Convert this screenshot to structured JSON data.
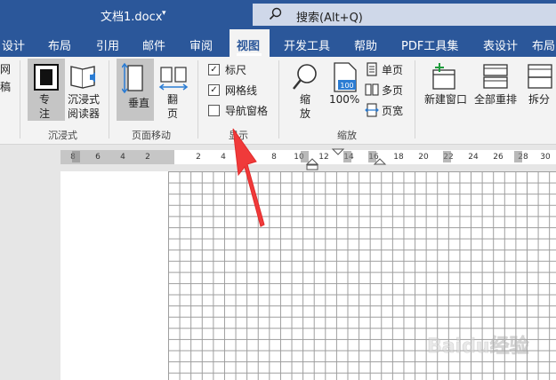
{
  "window": {
    "title": "文档1.docx",
    "title_caret": "▾"
  },
  "search": {
    "label": "搜索(Alt+Q)"
  },
  "tabs": [
    "设计",
    "布局",
    "引用",
    "邮件",
    "审阅",
    "视图",
    "开发工具",
    "帮助",
    "PDF工具集",
    "表设计",
    "布局"
  ],
  "active_tab": "视图",
  "ribbon": {
    "left_partial": {
      "line1": "网",
      "line2": "稿"
    },
    "immersive": {
      "group_label": "沉浸式",
      "focus": {
        "line1": "专",
        "line2": "注"
      },
      "reader": {
        "line1": "沉浸式",
        "line2": "阅读器"
      }
    },
    "page_move": {
      "group_label": "页面移动",
      "vertical": {
        "label": "垂直"
      },
      "flip": {
        "line1": "翻",
        "line2": "页"
      }
    },
    "show": {
      "group_label": "显示",
      "ruler": {
        "label": "标尺",
        "checked": true,
        "mark": "✓"
      },
      "gridlines": {
        "label": "网格线",
        "checked": true,
        "mark": "✓"
      },
      "nav_pane": {
        "label": "导航窗格",
        "checked": false
      }
    },
    "zoom": {
      "group_label": "缩放",
      "zoom": {
        "line1": "缩",
        "line2": "放"
      },
      "hundred": {
        "badge": "100",
        "label": "100%"
      },
      "single": {
        "label": "单页"
      },
      "multi": {
        "label": "多页"
      },
      "width": {
        "label": "页宽"
      }
    },
    "window_group": {
      "new_window": {
        "label": "新建窗口"
      },
      "arrange_all": {
        "label": "全部重排"
      },
      "split": {
        "label": "拆分"
      }
    }
  },
  "ruler": {
    "left_ticks": [
      "8",
      "6",
      "4",
      "2"
    ],
    "right_ticks": [
      "2",
      "4",
      "6",
      "8",
      "10",
      "12",
      "14",
      "16",
      "18",
      "20",
      "22",
      "24",
      "26",
      "28",
      "30"
    ]
  },
  "watermark": {
    "text": "Baidu经验"
  },
  "colors": {
    "accent": "#2b579a",
    "ribbon_bg": "#f3f3f3",
    "grid_line": "#9c9c9c",
    "arrow": "#f03a3a"
  }
}
